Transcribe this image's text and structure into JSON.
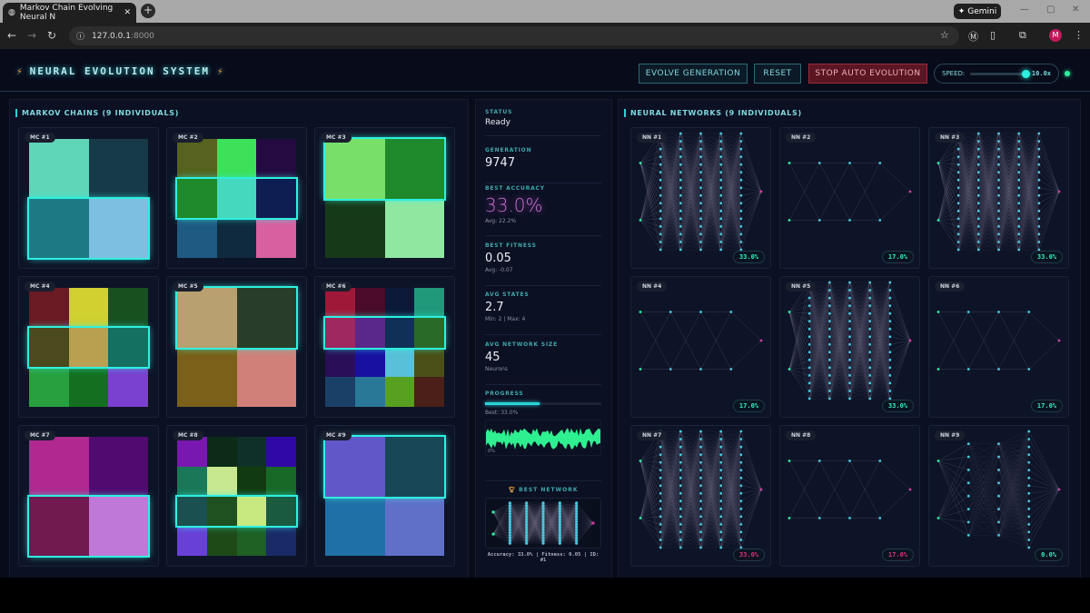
{
  "browser": {
    "tab_title": "Markov Chain Evolving Neural N",
    "url": "127.0.0.1",
    "url_port": ":8000",
    "gemini": "Gemini",
    "avatar": "M"
  },
  "header": {
    "title": "NEURAL EVOLUTION SYSTEM",
    "evolve": "EVOLVE GENERATION",
    "reset": "RESET",
    "stop": "STOP AUTO EVOLUTION",
    "speed_label": "SPEED:",
    "speed_value": "10.0x",
    "speed_fraction": 1.0
  },
  "markov": {
    "title": "MARKOV CHAINS (9 INDIVIDUALS)",
    "chains": [
      {
        "label": "MC #1",
        "hl": 1,
        "rows": [
          [
            "#5fd6b8",
            "#173a48"
          ],
          [
            "#1d7a85",
            "#7cbfe0"
          ]
        ]
      },
      {
        "label": "MC #2",
        "hl": 1,
        "rows": [
          [
            "#56621e",
            "#3ee05a",
            "#240a40"
          ],
          [
            "#1e8a2c",
            "#46d8be",
            "#0f1e52"
          ],
          [
            "#1f5a82",
            "#0f2a3e",
            "#d860a0"
          ]
        ]
      },
      {
        "label": "MC #3",
        "hl": 0,
        "rows": [
          [
            "#78e068",
            "#1e8a2c"
          ],
          [
            "#163a18",
            "#90e8a0"
          ]
        ]
      },
      {
        "label": "MC #4",
        "hl": 1,
        "rows": [
          [
            "#6a1a22",
            "#d0d030",
            "#185020"
          ],
          [
            "#4a4a1e",
            "#b8a050",
            "#147060"
          ],
          [
            "#28a040",
            "#147020",
            "#7a40d0"
          ]
        ]
      },
      {
        "label": "MC #5",
        "hl": 0,
        "rows": [
          [
            "#b8a070",
            "#283e2a"
          ],
          [
            "#7a6018",
            "#d08078"
          ]
        ]
      },
      {
        "label": "MC #6",
        "hl": 1,
        "rows": [
          [
            "#a01838",
            "#4a0a28",
            "#0c1838",
            "#20987a"
          ],
          [
            "#a02860",
            "#5a2888",
            "#103058",
            "#2a6a28"
          ],
          [
            "#2a0e58",
            "#1810a0",
            "#58c0d8",
            "#4a5018"
          ],
          [
            "#1a4068",
            "#2a7898",
            "#58a020",
            "#4a2018"
          ]
        ]
      },
      {
        "label": "MC #7",
        "hl": 1,
        "rows": [
          [
            "#b02890",
            "#500a70"
          ],
          [
            "#701a50",
            "#c078d8"
          ]
        ]
      },
      {
        "label": "MC #8",
        "hl": 2,
        "rows": [
          [
            "#7818b0",
            "#0c2a18",
            "#0e3028",
            "#3008a8"
          ],
          [
            "#1a7858",
            "#c8e890",
            "#123a10",
            "#186828"
          ],
          [
            "#1a5050",
            "#1e5020",
            "#c8e880",
            "#1a5a40"
          ],
          [
            "#6840d8",
            "#1e4a18",
            "#1e6024",
            "#1a2a68"
          ]
        ]
      },
      {
        "label": "MC #9",
        "hl": 0,
        "rows": [
          [
            "#6058c8",
            "#184858"
          ],
          [
            "#2070a8",
            "#6070c8"
          ]
        ]
      }
    ]
  },
  "stats": {
    "status": {
      "label": "STATUS",
      "value": "Ready"
    },
    "generation": {
      "label": "GENERATION",
      "value": "9747"
    },
    "best_accuracy": {
      "label": "BEST ACCURACY",
      "value": "33.0%",
      "sub": "Avg: 22.2%"
    },
    "best_fitness": {
      "label": "BEST FITNESS",
      "value": "0.05",
      "sub": "Avg: -0.07"
    },
    "avg_states": {
      "label": "AVG STATES",
      "value": "2.7",
      "sub": "Min: 2 | Max: 4"
    },
    "avg_network": {
      "label": "AVG NETWORK SIZE",
      "value": "45",
      "sub": "Neurons"
    },
    "progress": {
      "label": "PROGRESS",
      "fraction": 0.47,
      "sub": "Best: 33.0%"
    },
    "sparkline_label": "0%",
    "best_network": {
      "title": "BEST NETWORK",
      "layers": [
        2,
        16,
        16,
        16,
        16,
        16,
        1
      ],
      "caption": "Accuracy: 33.0% | Fitness: 0.05 | ID: #1"
    }
  },
  "networks": {
    "title": "NEURAL NETWORKS (9 INDIVIDUALS)",
    "colors": {
      "good": "#2ef0c0",
      "bad": "#e0307a"
    },
    "items": [
      {
        "label": "NN #1",
        "layers": [
          2,
          16,
          16,
          16,
          16,
          16,
          1
        ],
        "accuracy": "33.0%",
        "status": "good"
      },
      {
        "label": "NN #2",
        "layers": [
          2,
          2,
          2,
          2,
          1
        ],
        "accuracy": "17.0%",
        "status": "good"
      },
      {
        "label": "NN #3",
        "layers": [
          2,
          16,
          16,
          16,
          16,
          16,
          1
        ],
        "accuracy": "33.0%",
        "status": "good"
      },
      {
        "label": "NN #4",
        "layers": [
          2,
          2,
          2,
          2,
          1
        ],
        "accuracy": "17.0%",
        "status": "good"
      },
      {
        "label": "NN #5",
        "layers": [
          2,
          16,
          16,
          16,
          16,
          16,
          1
        ],
        "accuracy": "33.0%",
        "status": "good"
      },
      {
        "label": "NN #6",
        "layers": [
          2,
          2,
          2,
          2,
          1
        ],
        "accuracy": "17.0%",
        "status": "good"
      },
      {
        "label": "NN #7",
        "layers": [
          2,
          16,
          16,
          16,
          16,
          16,
          1
        ],
        "accuracy": "33.0%",
        "status": "bad"
      },
      {
        "label": "NN #8",
        "layers": [
          2,
          2,
          2,
          2,
          1
        ],
        "accuracy": "17.0%",
        "status": "bad"
      },
      {
        "label": "NN #9",
        "layers": [
          2,
          8,
          8,
          16,
          1
        ],
        "accuracy": "0.0%",
        "status": "good"
      }
    ]
  }
}
